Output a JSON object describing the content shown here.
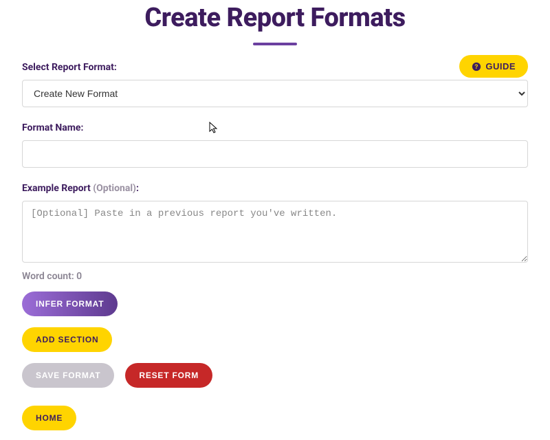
{
  "header": {
    "title": "Create Report Formats",
    "guide_label": "GUIDE"
  },
  "form": {
    "select_label": "Select Report Format:",
    "select_value": "Create New Format",
    "select_options": [
      "Create New Format"
    ],
    "name_label": "Format Name:",
    "name_value": "",
    "example_label": "Example Report ",
    "example_optional": "(Optional)",
    "example_colon": ":",
    "example_placeholder": "[Optional] Paste in a previous report you've written.",
    "example_value": "",
    "word_count_label": "Word count: ",
    "word_count_value": "0"
  },
  "buttons": {
    "infer_format": "INFER FORMAT",
    "add_section": "ADD SECTION",
    "save_format": "SAVE FORMAT",
    "reset_form": "RESET FORM",
    "home": "HOME"
  }
}
